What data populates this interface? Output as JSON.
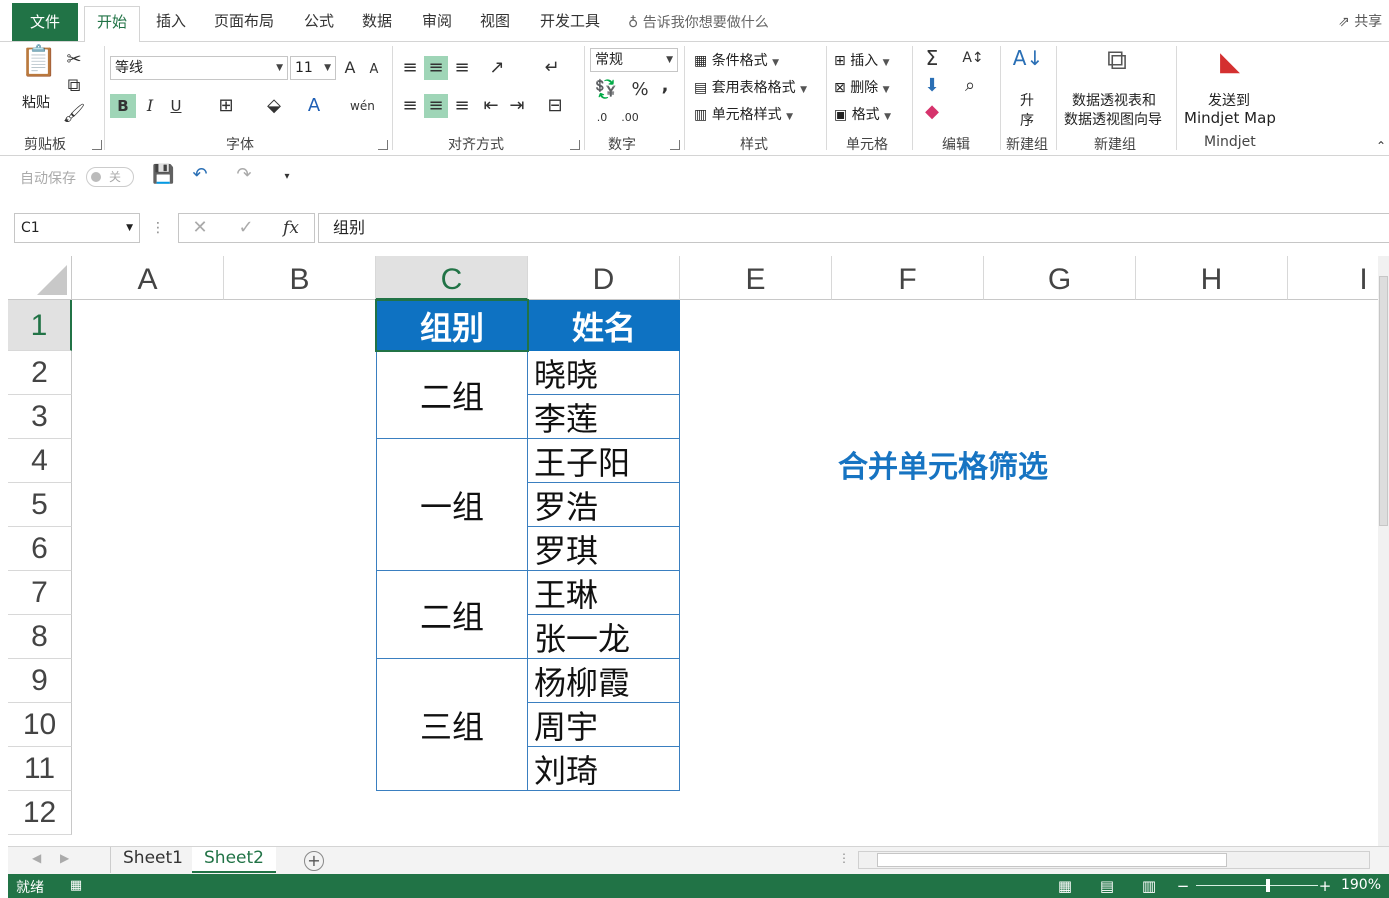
{
  "tabs": {
    "file": "文件",
    "items": [
      "开始",
      "插入",
      "页面布局",
      "公式",
      "数据",
      "审阅",
      "视图",
      "开发工具"
    ],
    "tell_me": "告诉我你想要做什么",
    "share": "共享"
  },
  "ribbon": {
    "clipboard": {
      "paste": "粘贴",
      "label": "剪贴板"
    },
    "font": {
      "name": "等线",
      "size": "11",
      "bold": "B",
      "italic": "I",
      "underline": "U",
      "grow": "A",
      "shrink": "A",
      "label": "字体"
    },
    "alignment": {
      "label": "对齐方式"
    },
    "number": {
      "format": "常规",
      "percent": "%",
      "comma": ",",
      "label": "数字"
    },
    "styles": {
      "conditional": "条件格式",
      "table": "套用表格格式",
      "cell": "单元格样式",
      "label": "样式"
    },
    "cells": {
      "insert": "插入",
      "delete": "删除",
      "format": "格式",
      "label": "单元格"
    },
    "editing": {
      "label": "编辑"
    },
    "sort": {
      "line1": "升",
      "line2": "序",
      "label": "新建组"
    },
    "pivot": {
      "line1": "数据透视表和",
      "line2": "数据透视图向导",
      "label": "新建组"
    },
    "mindjet": {
      "line1": "发送到",
      "line2": "Mindjet Map",
      "label": "Mindjet"
    }
  },
  "qat": {
    "autosave": "自动保存",
    "toggle": "关"
  },
  "formula_bar": {
    "name_box": "C1",
    "cancel": "✕",
    "enter": "✓",
    "fx": "fx",
    "formula": "组别"
  },
  "grid": {
    "columns": [
      "A",
      "B",
      "C",
      "D",
      "E",
      "F",
      "G",
      "H",
      "I"
    ],
    "rows": [
      "1",
      "2",
      "3",
      "4",
      "5",
      "6",
      "7",
      "8",
      "9",
      "10",
      "11",
      "12"
    ],
    "header": {
      "group": "组别",
      "name": "姓名"
    },
    "groups": [
      "二组",
      "一组",
      "二组",
      "三组"
    ],
    "names": [
      "晓晓",
      "李莲",
      "王子阳",
      "罗浩",
      "罗琪",
      "王琳",
      "张一龙",
      "杨柳霞",
      "周宇",
      "刘琦"
    ],
    "annotation": "合并单元格筛选"
  },
  "sheets": {
    "tabs": [
      "Sheet1",
      "Sheet2"
    ],
    "active": "Sheet2"
  },
  "status": {
    "ready": "就绪",
    "zoom": "190%"
  },
  "colors": {
    "accent": "#217346",
    "header_fill": "#0e72c2",
    "annotation": "#1774c2"
  }
}
